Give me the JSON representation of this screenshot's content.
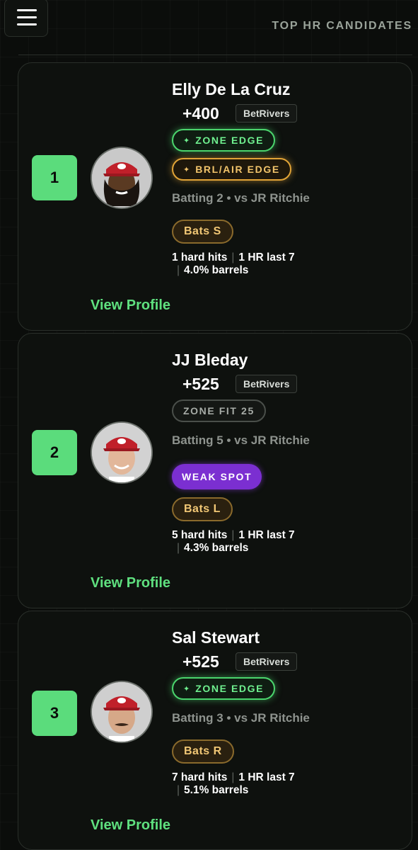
{
  "header": {
    "title": "TOP HR CANDIDATES"
  },
  "colors": {
    "accent_green": "#5bdc7c",
    "zone_edge": "#4bd56d",
    "brl_air_edge": "#e2a437",
    "weak_spot": "#7b2fd1",
    "background": "#0b0d0b"
  },
  "players": [
    {
      "rank": "1",
      "name": "Elly De La Cruz",
      "odds": "+400",
      "sportsbook": "BetRivers",
      "badges": [
        "ZONE EDGE",
        "BRL/AIR EDGE"
      ],
      "batting": "Batting 2 • vs JR Ritchie",
      "bats": "Bats S",
      "hard_hits": "1 hard hits",
      "hr_last7": "1 HR last 7",
      "barrels": "4.0% barrels",
      "view_profile": "View Profile"
    },
    {
      "rank": "2",
      "name": "JJ Bleday",
      "odds": "+525",
      "sportsbook": "BetRivers",
      "badges": [
        "ZONE FIT 25",
        "WEAK SPOT"
      ],
      "batting": "Batting 5 • vs JR Ritchie",
      "bats": "Bats L",
      "hard_hits": "5 hard hits",
      "hr_last7": "1 HR last 7",
      "barrels": "4.3% barrels",
      "view_profile": "View Profile"
    },
    {
      "rank": "3",
      "name": "Sal Stewart",
      "odds": "+525",
      "sportsbook": "BetRivers",
      "badges": [
        "ZONE EDGE"
      ],
      "batting": "Batting 3 • vs JR Ritchie",
      "bats": "Bats R",
      "hard_hits": "7 hard hits",
      "hr_last7": "1 HR last 7",
      "barrels": "5.1% barrels",
      "view_profile": "View Profile"
    }
  ]
}
